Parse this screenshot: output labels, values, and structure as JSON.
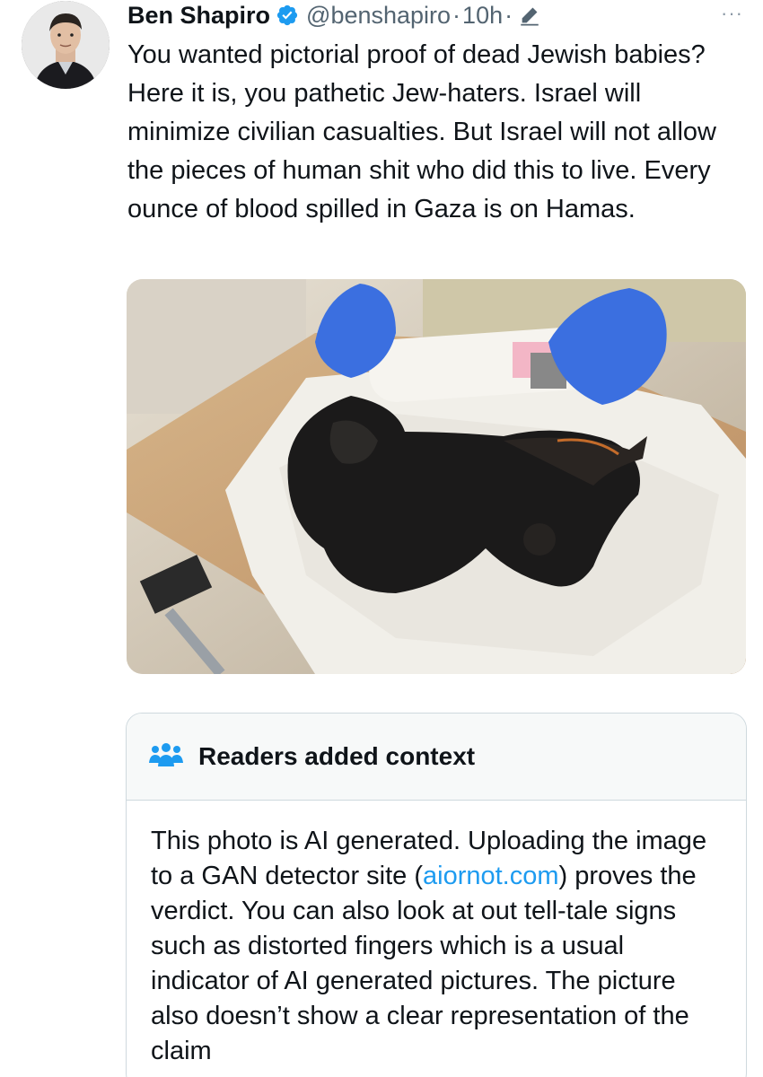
{
  "tweet": {
    "author_name": "Ben Shapiro",
    "handle": "@benshapiro",
    "separator": "·",
    "time": "10h",
    "separator2": "·",
    "more_label": "···",
    "text": "You wanted pictorial proof of dead Jewish babies? Here it is, you pathetic Jew-haters. Israel will minimize civilian casualties. But Israel will not allow the pieces of human shit who did this to live. Every ounce of blood spilled in Gaza is on Hamas."
  },
  "icons": {
    "verified": "verified-badge-icon",
    "edit": "edit-pencil-icon",
    "more": "more-dots-icon",
    "community": "community-notes-icon"
  },
  "note": {
    "title": "Readers added context",
    "body_part1": "This photo is AI generated. Uploading the image to a GAN detector site (",
    "link_text": "aiornot.com",
    "body_part2": ") proves the verdict. You can also look at out tell-tale signs such as distorted fingers which is a usual indicator of AI generated pictures. The picture also doesn’t show a clear representation of the claim"
  },
  "colors": {
    "verified_blue": "#1d9bf0",
    "link_blue": "#1d9bf0",
    "secondary_text": "#536471",
    "note_header_bg": "#f7f9f9",
    "border": "#cfd9de"
  }
}
